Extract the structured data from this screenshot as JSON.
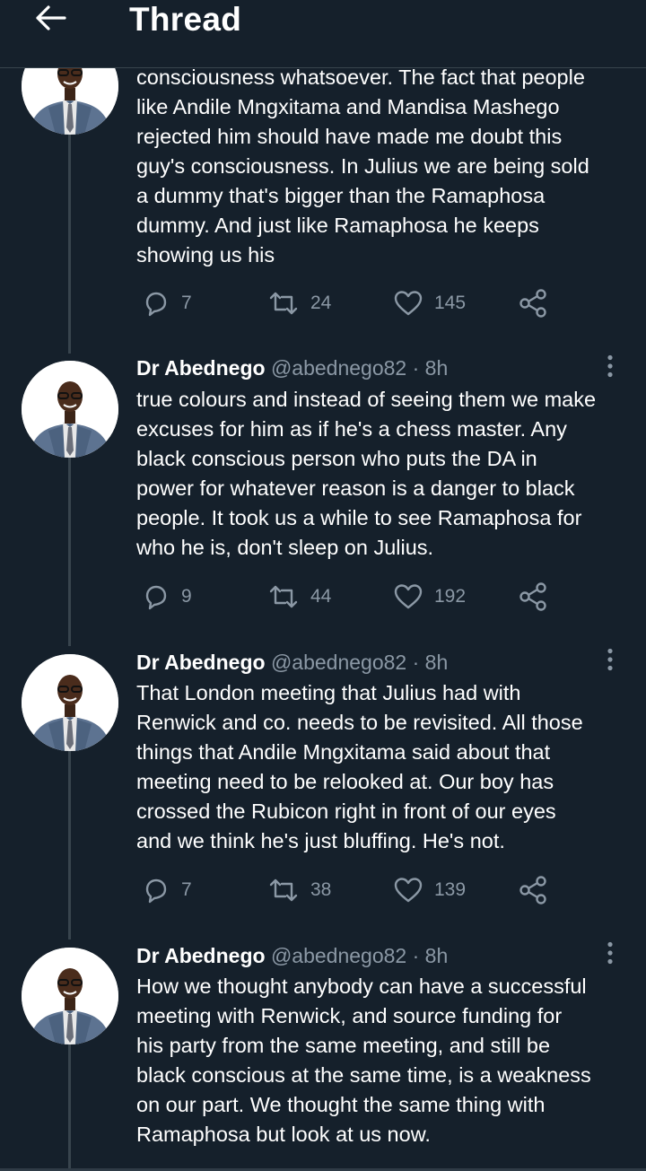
{
  "header": {
    "title": "Thread",
    "back_icon": "arrow-left-icon"
  },
  "colors": {
    "background": "#15202b",
    "text_primary": "#ffffff",
    "text_secondary": "#8b98a5",
    "divider": "#38444d"
  },
  "tweets": [
    {
      "text": "consciousness whatsoever. The fact that people\nlike Andile Mngxitama and Mandisa Mashego\nrejected him should have made me doubt this\nguy's consciousness. In Julius we are being sold\na dummy that's bigger than the Ramaphosa\ndummy. And just like Ramaphosa he keeps\nshowing us his",
      "replies": "7",
      "retweets": "24",
      "likes": "145"
    },
    {
      "author": "Dr Abednego",
      "handle": "@abednego82",
      "separator": "·",
      "time": "8h",
      "text": "true colours and instead of seeing them we make\nexcuses for him as if he's a chess master. Any\nblack conscious person who puts the DA in\npower for whatever reason is a danger to black\npeople. It took us a while to see Ramaphosa for\nwho he is, don't sleep on Julius.",
      "replies": "9",
      "retweets": "44",
      "likes": "192"
    },
    {
      "author": "Dr Abednego",
      "handle": "@abednego82",
      "separator": "·",
      "time": "8h",
      "text": "That London meeting that Julius had with\nRenwick and co. needs to be revisited. All those\nthings that Andile Mngxitama said about that\nmeeting need to be relooked at. Our boy has\ncrossed the Rubicon right in front of our eyes\nand we think he's just bluffing. He's not.",
      "replies": "7",
      "retweets": "38",
      "likes": "139"
    },
    {
      "author": "Dr Abednego",
      "handle": "@abednego82",
      "separator": "·",
      "time": "8h",
      "text": "How we thought anybody can have a successful\nmeeting with Renwick, and source funding for\nhis party from the same meeting, and still be\nblack conscious at the same time, is a weakness\non our part. We thought the same thing with\nRamaphosa but look at us now."
    }
  ],
  "icons": {
    "reply": "reply-icon",
    "retweet": "retweet-icon",
    "like": "heart-icon",
    "share": "share-icon",
    "more": "more-vertical-icon"
  }
}
